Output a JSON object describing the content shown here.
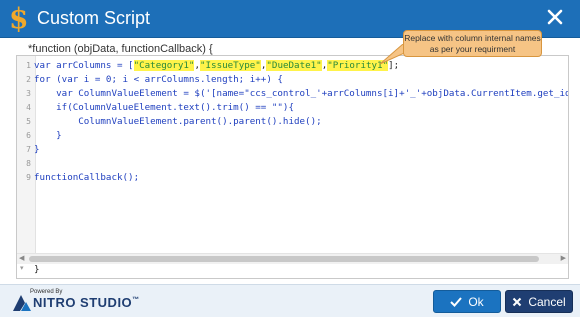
{
  "dialog": {
    "title": "Custom Script",
    "icon": "dollar-icon"
  },
  "editor": {
    "function_header": "*function (objData, functionCallback) {",
    "closing_brace": "}",
    "line_numbers": [
      "1",
      "2",
      "3",
      "4",
      "5",
      "6",
      "7",
      "8",
      "9"
    ]
  },
  "callout": {
    "text": "Replace with column internal names as per your requirment"
  },
  "code": {
    "l1_a": "var arrColumns = [",
    "l1_c1": "\"Category1\"",
    "l1_c2": "\"IssueType\"",
    "l1_c3": "\"DueDate1\"",
    "l1_c4": "\"Priority1\"",
    "l1_end": "];",
    "l2": "for (var i = 0; i < arrColumns.length; i++) {",
    "l3_a": "    var ColumnValueElement = $('[name=\"ccs_control_'+arrColumns[i]+'_'+objData.CurrentItem.get_id()+'\"",
    "l4": "    if(ColumnValueElement.text().trim() == \"\"){",
    "l5": "        ColumnValueElement.parent().parent().hide();",
    "l6": "    }",
    "l7": "}",
    "l9": "functionCallback();"
  },
  "footer": {
    "powered_by": "Powered By",
    "brand": "NITRO STUDIO",
    "trademark": "™",
    "ok_label": "Ok",
    "cancel_label": "Cancel"
  },
  "colors": {
    "titlebar": "#1d6fb8",
    "highlight": "#fff34a",
    "callout": "#f6c485",
    "ok_button": "#1b73c0",
    "cancel_button": "#1f3e72"
  }
}
